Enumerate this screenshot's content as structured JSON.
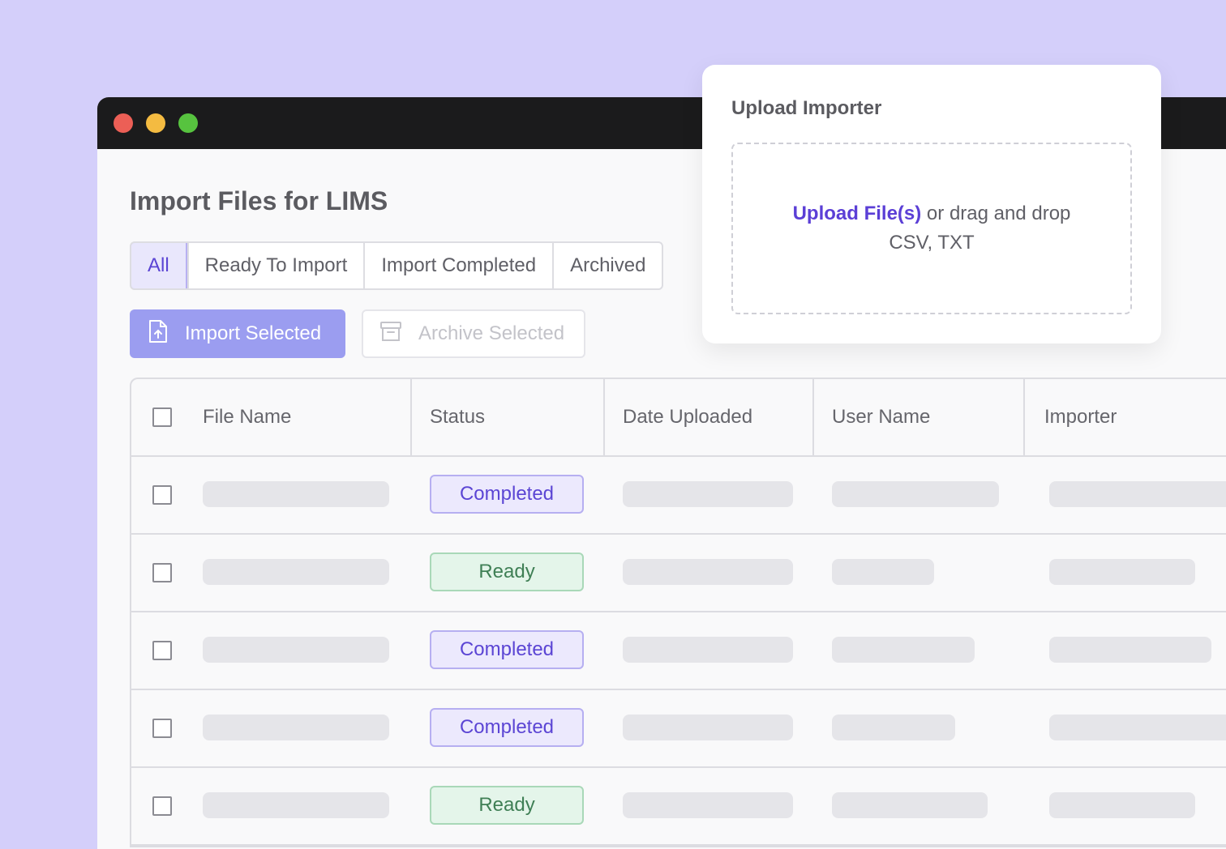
{
  "page": {
    "title": "Import Files for LIMS"
  },
  "tabs": [
    {
      "label": "All",
      "active": true
    },
    {
      "label": "Ready To Import",
      "active": false
    },
    {
      "label": "Import Completed",
      "active": false
    },
    {
      "label": "Archived",
      "active": false
    }
  ],
  "actions": {
    "import_label": "Import Selected",
    "archive_label": "Archive Selected"
  },
  "table": {
    "columns": [
      "File Name",
      "Status",
      "Date Uploaded",
      "User Name",
      "Importer"
    ],
    "rows": [
      {
        "status": "Completed"
      },
      {
        "status": "Ready"
      },
      {
        "status": "Completed"
      },
      {
        "status": "Completed"
      },
      {
        "status": "Ready"
      }
    ]
  },
  "upload": {
    "title": "Upload Importer",
    "link": "Upload File(s)",
    "hint": " or drag and drop",
    "formats": "CSV, TXT"
  },
  "colors": {
    "background": "#d4cffa",
    "accent": "#5b45d4",
    "completed_bg": "#ece9fd",
    "ready_bg": "#e4f5ea",
    "ready_text": "#3f7f55"
  }
}
